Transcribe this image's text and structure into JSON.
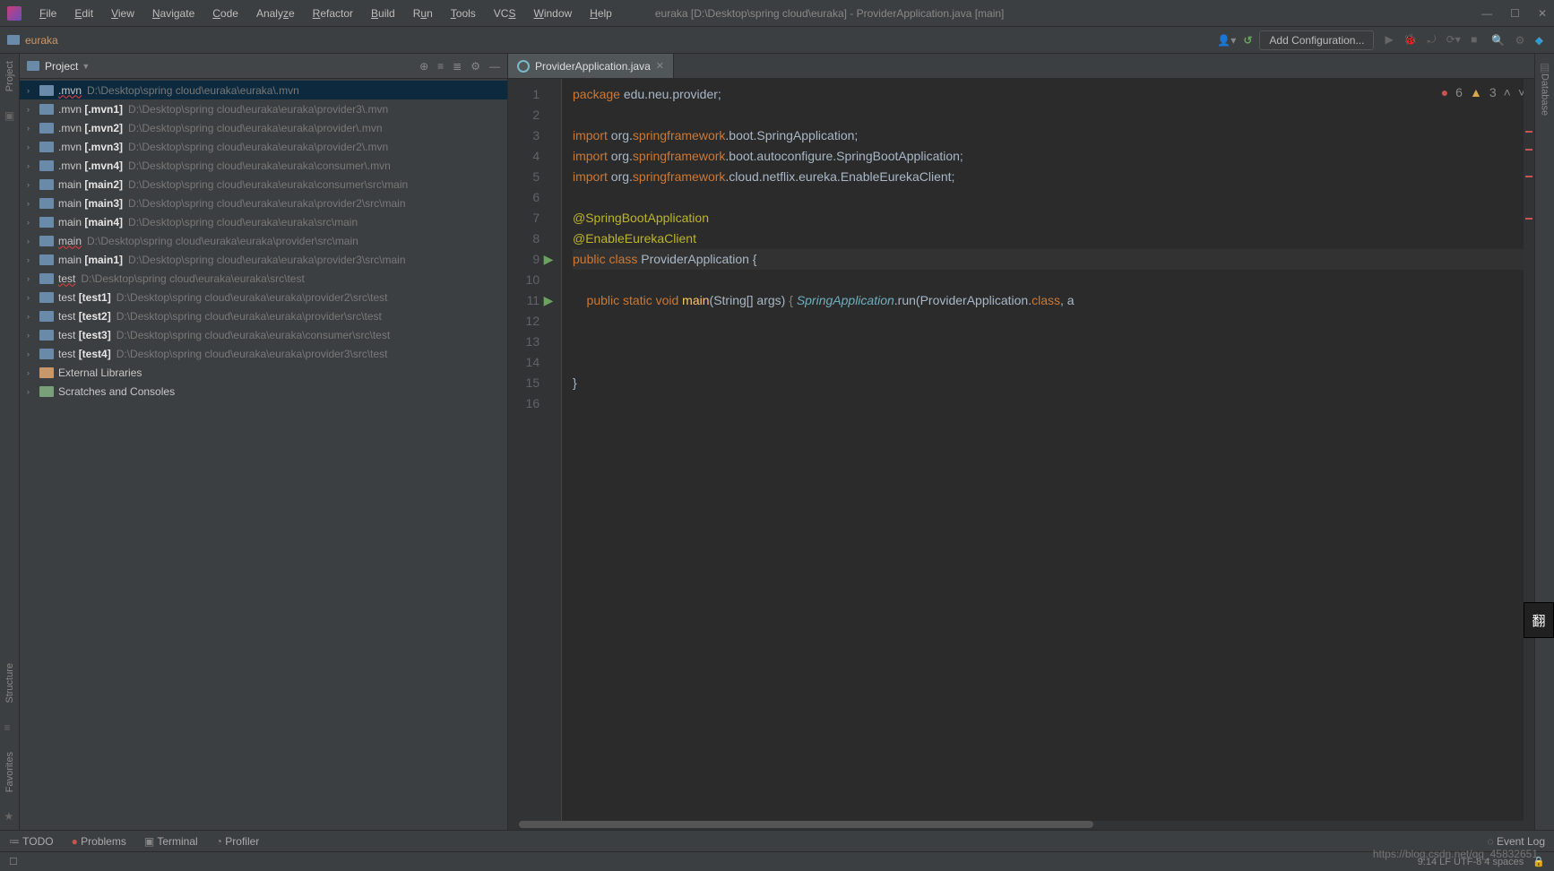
{
  "title": "euraka [D:\\Desktop\\spring cloud\\euraka] - ProviderApplication.java [main]",
  "menus": [
    "File",
    "Edit",
    "View",
    "Navigate",
    "Code",
    "Analyze",
    "Refactor",
    "Build",
    "Run",
    "Tools",
    "VCS",
    "Window",
    "Help"
  ],
  "breadcrumb": "euraka",
  "addConfig": "Add Configuration...",
  "projectPanel": {
    "title": "Project"
  },
  "sideLabels": {
    "project": "Project",
    "structure": "Structure",
    "favorites": "Favorites",
    "database": "Database"
  },
  "tree": [
    {
      "name": ".mvn",
      "bold": "",
      "path": "D:\\Desktop\\spring cloud\\euraka\\euraka\\.mvn",
      "selected": true,
      "wavy": true
    },
    {
      "name": ".mvn ",
      "bold": "[.mvn1]",
      "path": "D:\\Desktop\\spring cloud\\euraka\\euraka\\provider3\\.mvn"
    },
    {
      "name": ".mvn ",
      "bold": "[.mvn2]",
      "path": "D:\\Desktop\\spring cloud\\euraka\\euraka\\provider\\.mvn"
    },
    {
      "name": ".mvn ",
      "bold": "[.mvn3]",
      "path": "D:\\Desktop\\spring cloud\\euraka\\euraka\\provider2\\.mvn"
    },
    {
      "name": ".mvn ",
      "bold": "[.mvn4]",
      "path": "D:\\Desktop\\spring cloud\\euraka\\euraka\\consumer\\.mvn"
    },
    {
      "name": "main ",
      "bold": "[main2]",
      "path": "D:\\Desktop\\spring cloud\\euraka\\euraka\\consumer\\src\\main"
    },
    {
      "name": "main ",
      "bold": "[main3]",
      "path": "D:\\Desktop\\spring cloud\\euraka\\euraka\\provider2\\src\\main"
    },
    {
      "name": "main ",
      "bold": "[main4]",
      "path": "D:\\Desktop\\spring cloud\\euraka\\euraka\\src\\main"
    },
    {
      "name": "main",
      "bold": "",
      "path": "D:\\Desktop\\spring cloud\\euraka\\euraka\\provider\\src\\main",
      "wavy": true
    },
    {
      "name": "main ",
      "bold": "[main1]",
      "path": "D:\\Desktop\\spring cloud\\euraka\\euraka\\provider3\\src\\main"
    },
    {
      "name": "test",
      "bold": "",
      "path": "D:\\Desktop\\spring cloud\\euraka\\euraka\\src\\test",
      "wavy": true
    },
    {
      "name": "test ",
      "bold": "[test1]",
      "path": "D:\\Desktop\\spring cloud\\euraka\\euraka\\provider2\\src\\test"
    },
    {
      "name": "test ",
      "bold": "[test2]",
      "path": "D:\\Desktop\\spring cloud\\euraka\\euraka\\provider\\src\\test"
    },
    {
      "name": "test ",
      "bold": "[test3]",
      "path": "D:\\Desktop\\spring cloud\\euraka\\euraka\\consumer\\src\\test"
    },
    {
      "name": "test ",
      "bold": "[test4]",
      "path": "D:\\Desktop\\spring cloud\\euraka\\euraka\\provider3\\src\\test"
    },
    {
      "name": "External Libraries",
      "bold": "",
      "path": "",
      "icon": "lib"
    },
    {
      "name": "Scratches and Consoles",
      "bold": "",
      "path": "",
      "icon": "sc"
    }
  ],
  "tab": {
    "label": "ProviderApplication.java"
  },
  "indicators": {
    "errors": "6",
    "warnings": "3"
  },
  "gutter": [
    "1",
    "2",
    "3",
    "4",
    "5",
    "6",
    "7",
    "8",
    "9",
    "10",
    "11",
    "12",
    "13",
    "14",
    "15",
    "16"
  ],
  "runMarks": {
    "9": "▶",
    "11": "▶"
  },
  "code": {
    "l1": {
      "a": "package",
      "b": " edu.neu.provider;"
    },
    "l3": {
      "a": "import",
      "b": " org.",
      "c": "springframework",
      "d": ".boot.SpringApplication;"
    },
    "l4": {
      "a": "import",
      "b": " org.",
      "c": "springframework",
      "d": ".boot.autoconfigure.SpringBootApplication;"
    },
    "l5": {
      "a": "import",
      "b": " org.",
      "c": "springframework",
      "d": ".cloud.netflix.eureka.EnableEurekaClient;"
    },
    "l7": {
      "a": "@",
      "b": "SpringBootApplication"
    },
    "l8": {
      "a": "@",
      "b": "EnableEurekaClient"
    },
    "l9": {
      "a": "public class",
      "b": " ProviderApplication {"
    },
    "l11": {
      "a": "    public static void ",
      "b": "main",
      "c": "(String[] args) ",
      "d": "{ ",
      "e": "SpringApplication",
      "f": ".run(ProviderApplication.",
      "g": "class",
      "h": ", a"
    },
    "l13": "",
    "l14": "",
    "l15": "}"
  },
  "bottom": {
    "todo": "TODO",
    "problems": "Problems",
    "terminal": "Terminal",
    "profiler": "Profiler",
    "eventlog": "Event Log"
  },
  "status": {
    "right": "9:14   LF   UTF-8   4 spaces"
  },
  "watermark": "https://blog.csdn.net/qq_45832651",
  "fanyi": "翻"
}
